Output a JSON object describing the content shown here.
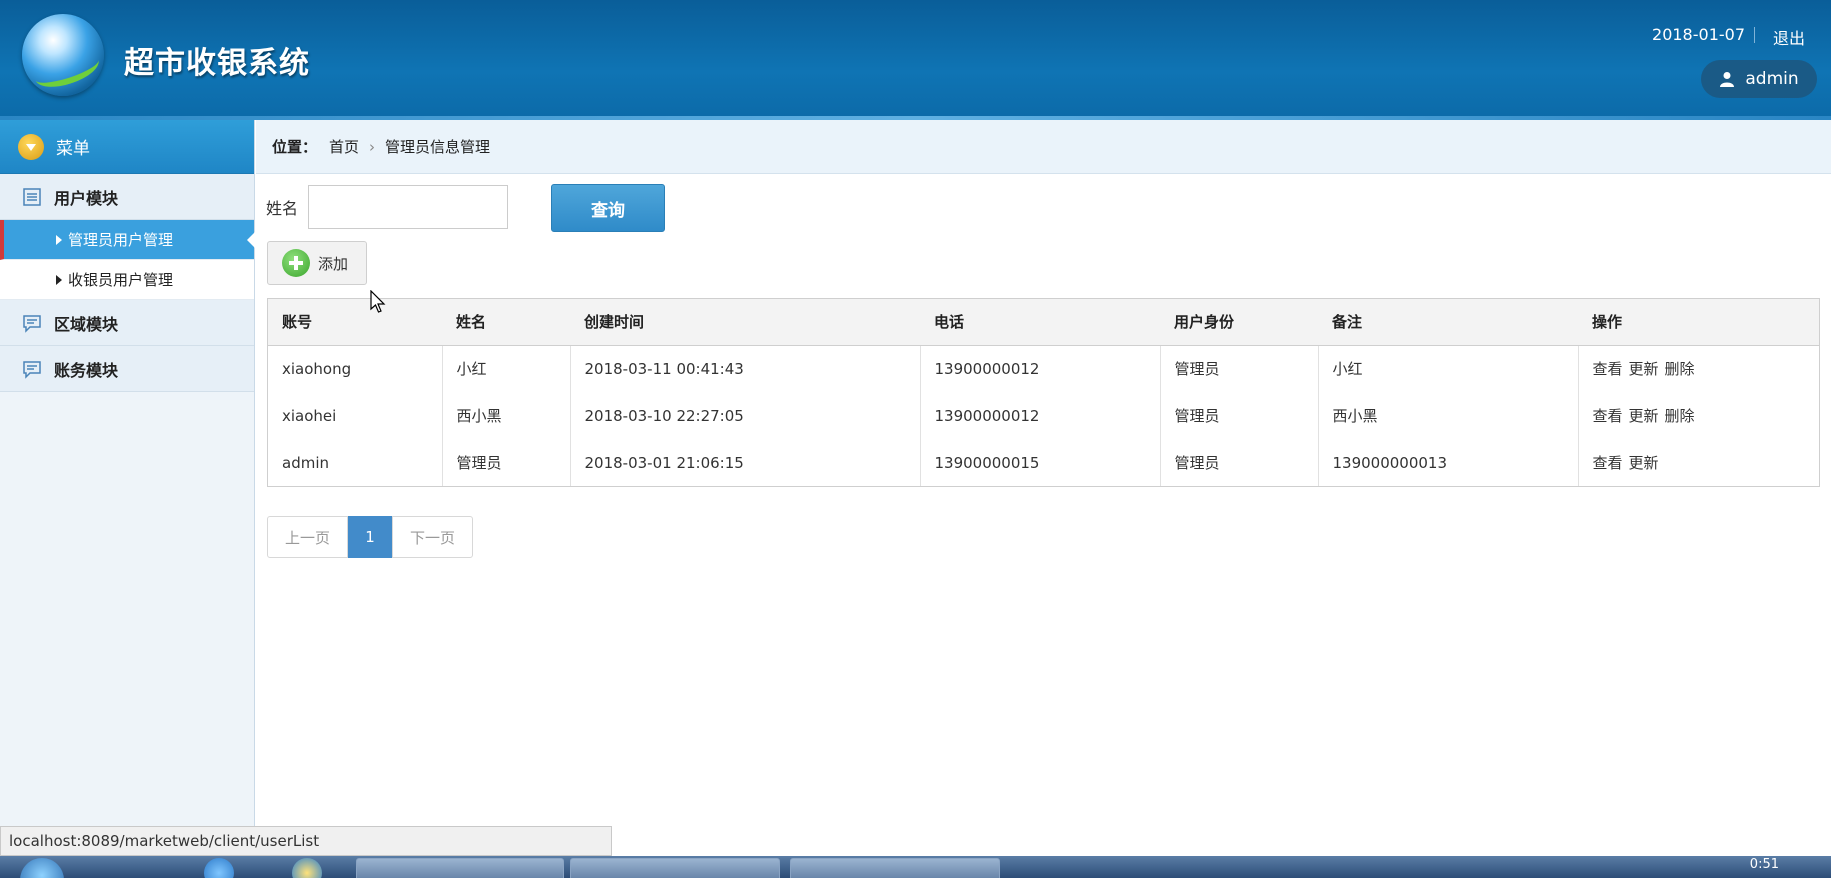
{
  "header": {
    "title": "超市收银系统",
    "date": "2018-01-07",
    "logout": "退出",
    "user": "admin"
  },
  "sidebar": {
    "menu_label": "菜单",
    "modules": [
      {
        "label": "用户模块",
        "items": [
          "管理员用户管理",
          "收银员用户管理"
        ]
      },
      {
        "label": "区域模块"
      },
      {
        "label": "账务模块"
      }
    ]
  },
  "breadcrumb": {
    "prefix": "位置：",
    "home": "首页",
    "current": "管理员信息管理"
  },
  "search": {
    "label": "姓名",
    "value": "",
    "button": "查询"
  },
  "add_button": "添加",
  "table": {
    "headers": [
      "账号",
      "姓名",
      "创建时间",
      "电话",
      "用户身份",
      "备注",
      "操作"
    ],
    "rows": [
      {
        "account": "xiaohong",
        "name": "小红",
        "created": "2018-03-11 00:41:43",
        "phone": "13900000012",
        "role": "管理员",
        "note": "小红",
        "ops": [
          "查看",
          "更新",
          "删除"
        ]
      },
      {
        "account": "xiaohei",
        "name": "西小黑",
        "created": "2018-03-10 22:27:05",
        "phone": "13900000012",
        "role": "管理员",
        "note": "西小黑",
        "ops": [
          "查看",
          "更新",
          "删除"
        ]
      },
      {
        "account": "admin",
        "name": "管理员",
        "created": "2018-03-01 21:06:15",
        "phone": "13900000015",
        "role": "管理员",
        "note": "139000000013",
        "ops": [
          "查看",
          "更新"
        ]
      }
    ]
  },
  "pager": {
    "prev": "上一页",
    "current": "1",
    "next": "下一页"
  },
  "status_url": "localhost:8089/marketweb/client/userList",
  "taskbar": {
    "clock": "0:51"
  },
  "colors": {
    "header": "#0f74b4",
    "active_item": "#3aa0de",
    "accent_bar": "#d23a3a",
    "pager_active": "#428bca"
  }
}
